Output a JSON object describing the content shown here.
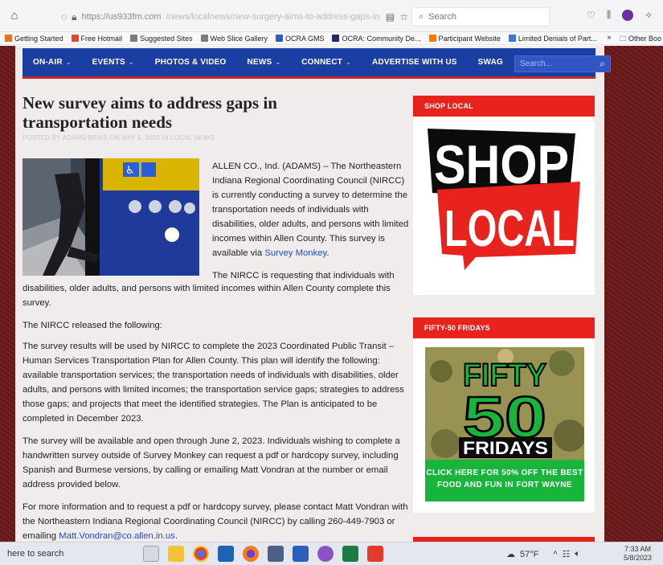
{
  "browser": {
    "url_host": "https://us933fm.com",
    "url_path": "/news/localnews/new-surgery-aims-to-address-gaps-in",
    "search_placeholder": "Search",
    "bookmarks": [
      {
        "label": "Getting Started",
        "color": "#e8731e"
      },
      {
        "label": "Free Hotmail",
        "color": "#e24b2a"
      },
      {
        "label": "Suggested Sites",
        "color": "#7d7d7d"
      },
      {
        "label": "Web Slice Gallery",
        "color": "#7d7d7d"
      },
      {
        "label": "OCRA GMS",
        "color": "#2a5fc7"
      },
      {
        "label": "OCRA: Community De...",
        "color": "#222a6b"
      },
      {
        "label": "Participant Website",
        "color": "#f07a10"
      },
      {
        "label": "Limited Denials of Part...",
        "color": "#3b78d8"
      }
    ],
    "bookmarks_more": "»",
    "other_bookmarks": "Other Boo"
  },
  "nav": {
    "items": [
      {
        "label": "ON-AIR",
        "dropdown": true
      },
      {
        "label": "EVENTS",
        "dropdown": true
      },
      {
        "label": "PHOTOS & VIDEO",
        "dropdown": false
      },
      {
        "label": "NEWS",
        "dropdown": true
      },
      {
        "label": "CONNECT",
        "dropdown": true
      },
      {
        "label": "ADVERTISE WITH US",
        "dropdown": false
      },
      {
        "label": "SWAG",
        "dropdown": false
      }
    ],
    "search_placeholder": "Search..."
  },
  "article": {
    "title": "New survey aims to address gaps in transportation needs",
    "byline": "POSTED BY ADAMS NEWS ON MAY 5, 2023 IN LOCAL NEWS",
    "lede_text": "ALLEN CO., Ind. (ADAMS) – The Northeastern Indiana Regional Coordinating Council (NIRCC) is currently conducting a survey to determine the transportation needs of individuals with disabilities, older adults, and persons with limited incomes within Allen County. This survey is available via ",
    "lede_link": "Survey Monkey",
    "lede_end": ".",
    "p2_first": "The NIRCC is requesting that individuals with",
    "p2_rest": "disabilities, older adults, and persons with limited incomes within Allen County complete this survey.",
    "p3": "The NIRCC released the following:",
    "p4": "The survey results will be used by NIRCC to complete the 2023 Coordinated Public Transit – Human Services Transportation Plan for Allen County. This plan will identify the following: available transportation services; the transportation needs of individuals with disabilities, older adults, and persons with limited incomes; the transportation service gaps; strategies to address those gaps; and projects that meet the identified strategies. The Plan is anticipated to be completed in December 2023.",
    "p5": "The survey will be available and open through June 2, 2023. Individuals wishing to complete a handwritten survey outside of Survey Monkey can request a pdf or hardcopy survey, including Spanish and Burmese versions, by calling or emailing Matt Vondran at the number or email address provided below.",
    "p6": "For more information and to request a pdf or hardcopy survey, please contact Matt Vondran with the Northeastern Indiana Regional Coordinating Council (NIRCC) by calling 260-449-7903 or emailing ",
    "p6_link": "Matt.Vondran@co.allen.in.us",
    "p6_end": "."
  },
  "sidebar": {
    "shop_local": {
      "header": "SHOP LOCAL",
      "word1": "SHOP",
      "word2": "LOCAL"
    },
    "fifty": {
      "header": "FIFTY-50 FRIDAYS",
      "line1": "FIFTY",
      "line2": "50",
      "line3": "FRIDAYS",
      "promo": "CLICK HERE FOR 50% OFF THE BEST FOOD AND FUN IN FORT WAYNE"
    }
  },
  "taskbar": {
    "search_text": "here to search",
    "weather": "57°F",
    "time": "7:33 AM",
    "date": "5/8/2023"
  },
  "colors": {
    "nav": "#1b3ea3",
    "accent_red": "#e8231e",
    "link": "#1f4bd1",
    "promo_green": "#19b43c"
  }
}
